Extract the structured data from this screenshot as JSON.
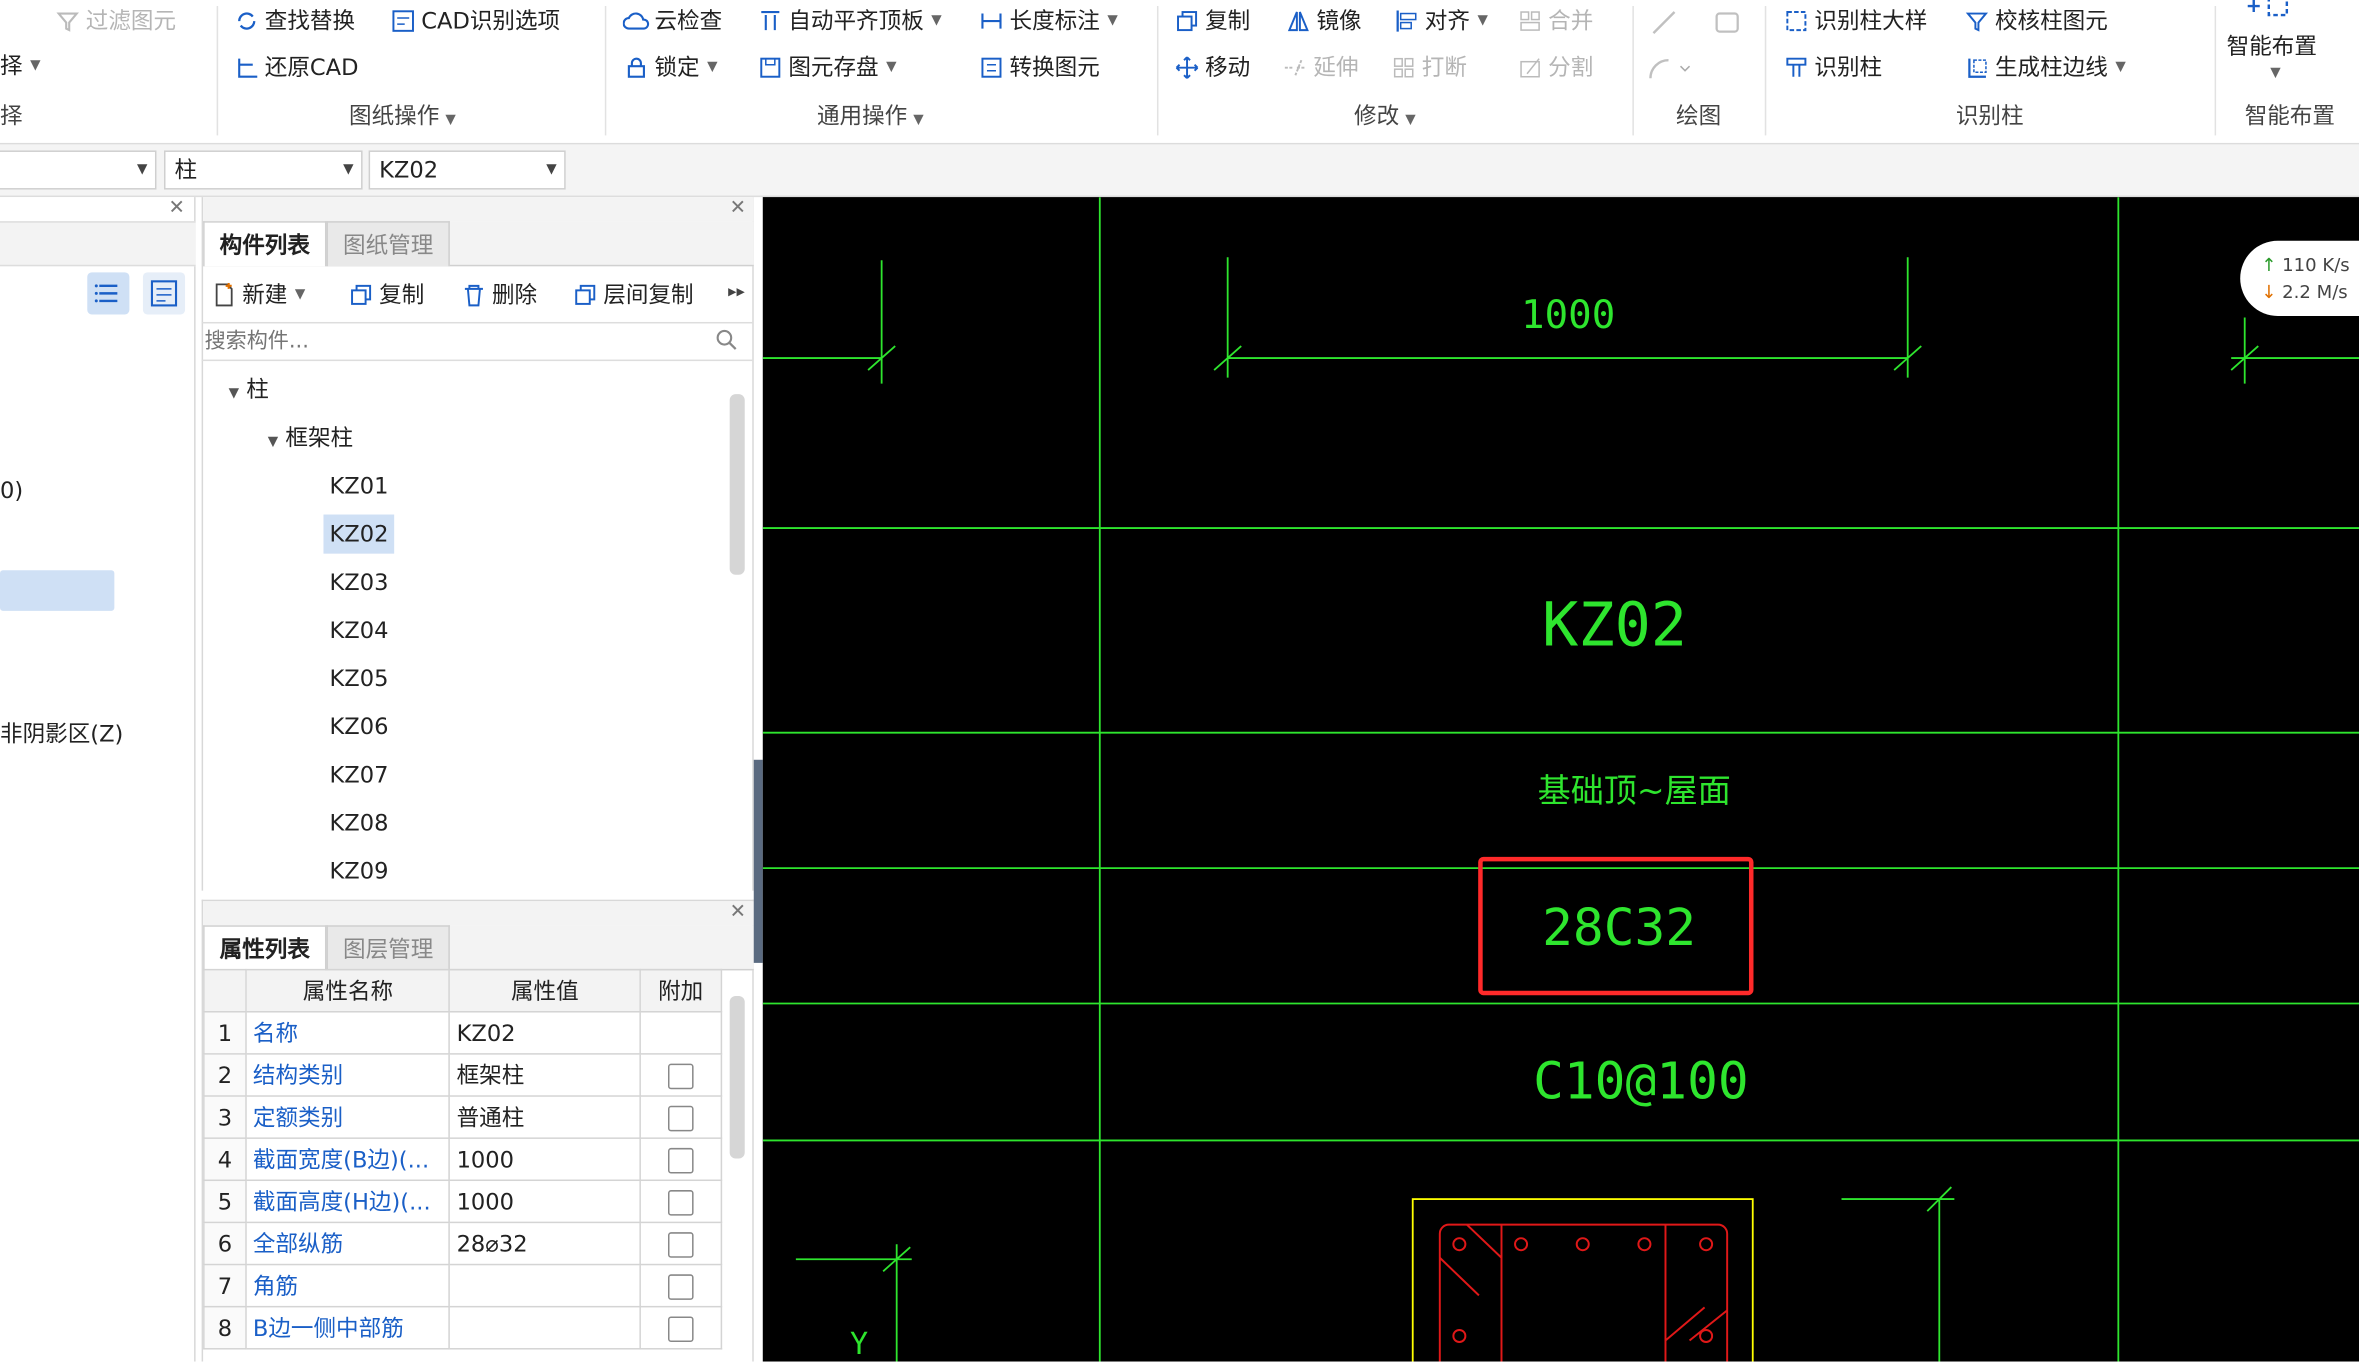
{
  "ribbon": {
    "left_partial": {
      "filter": "过滤图元",
      "item2": "择",
      "item3": "择"
    },
    "drawing_ops": {
      "find_replace": "查找替换",
      "cad_options": "CAD识别选项",
      "restore_cad": "还原CAD",
      "group": "图纸操作"
    },
    "general_ops": {
      "cloud_check": "云检查",
      "auto_align_top": "自动平齐顶板",
      "length_dim": "长度标注",
      "lock": "锁定",
      "element_save": "图元存盘",
      "convert": "转换图元",
      "group": "通用操作"
    },
    "modify": {
      "copy": "复制",
      "mirror": "镜像",
      "align": "对齐",
      "merge": "合并",
      "move": "移动",
      "extend": "延伸",
      "break": "打断",
      "split": "分割",
      "group": "修改"
    },
    "draw": {
      "group": "绘图"
    },
    "identify_column": {
      "column_detail": "识别柱大样",
      "check_column": "校核柱图元",
      "identify": "识别柱",
      "gen_edge": "生成柱边线",
      "group": "识别柱"
    },
    "smart": {
      "label": "智能布置",
      "group": "智能布置"
    }
  },
  "selectors": {
    "first": "",
    "type": "柱",
    "component": "KZ02"
  },
  "left_panel": {
    "text1": "0)",
    "text2": "非阴影区(Z)"
  },
  "component_panel": {
    "tabs": [
      "构件列表",
      "图纸管理"
    ],
    "actions": {
      "new": "新建",
      "copy": "复制",
      "delete": "删除",
      "floor_copy": "层间复制"
    },
    "search_placeholder": "搜索构件...",
    "tree": {
      "root": "柱",
      "child": "框架柱",
      "items": [
        "KZ01",
        "KZ02",
        "KZ03",
        "KZ04",
        "KZ05",
        "KZ06",
        "KZ07",
        "KZ08",
        "KZ09"
      ],
      "selected": "KZ02"
    }
  },
  "property_panel": {
    "tabs": [
      "属性列表",
      "图层管理"
    ],
    "headers": [
      "属性名称",
      "属性值",
      "附加"
    ],
    "rows": [
      {
        "num": "1",
        "name": "名称",
        "value": "KZ02",
        "checkbox": false
      },
      {
        "num": "2",
        "name": "结构类别",
        "value": "框架柱",
        "checkbox": true
      },
      {
        "num": "3",
        "name": "定额类别",
        "value": "普通柱",
        "checkbox": true
      },
      {
        "num": "4",
        "name": "截面宽度(B边)(...",
        "value": "1000",
        "checkbox": true
      },
      {
        "num": "5",
        "name": "截面高度(H边)(...",
        "value": "1000",
        "checkbox": true
      },
      {
        "num": "6",
        "name": "全部纵筋",
        "value": "28⌀32",
        "checkbox": true
      },
      {
        "num": "7",
        "name": "角筋",
        "value": "",
        "checkbox": true
      },
      {
        "num": "8",
        "name": "B边一侧中部筋",
        "value": "",
        "checkbox": true
      }
    ]
  },
  "cad": {
    "dimension": "1000",
    "column_id": "KZ02",
    "range": "基础顶~屋面",
    "rebar": "28C32",
    "stirrup": "C10@100",
    "axis": "Y"
  },
  "network": {
    "up": "110 K/s",
    "down": "2.2  M/s"
  },
  "colors": {
    "cad_bg": "#000000",
    "cad_line": "#2ee52e",
    "highlight": "#ff2a2a",
    "section": "#ffff00",
    "rebar": "#e01818",
    "selection": "#cfe0f5",
    "link": "#1a5fc7"
  }
}
